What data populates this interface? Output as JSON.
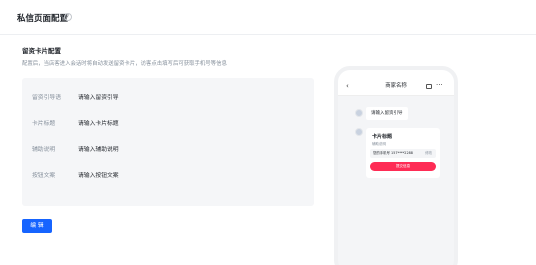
{
  "header": {
    "title": "私信页面配置"
  },
  "section": {
    "title": "留资卡片配置",
    "description": "配置后，当店客进入会话时将自动发送留资卡片，访客点击填写后可获取手机号等信息"
  },
  "form": {
    "rows": [
      {
        "label": "留资引导语",
        "placeholder": "请输入留资引导"
      },
      {
        "label": "卡片标题",
        "placeholder": "请输入卡片标题"
      },
      {
        "label": "辅助说明",
        "placeholder": "请输入辅助说明"
      },
      {
        "label": "按钮文案",
        "placeholder": "请输入按钮文案"
      }
    ]
  },
  "actions": {
    "edit_label": "编 辑"
  },
  "preview": {
    "title": "商家名称",
    "back_icon": "chevron-left-icon",
    "store_icon": "store-icon",
    "more_icon": "more-icon",
    "message": "请输入留资引导",
    "card": {
      "title": "卡片标题",
      "description": "辅助说明",
      "phone_label": "您的手机号 157****2288",
      "phone_edit": "修改",
      "button": "提交信息"
    }
  },
  "colors": {
    "primary": "#1664ff",
    "card_button": "#fe2c55",
    "form_background": "#f5f6f8"
  }
}
